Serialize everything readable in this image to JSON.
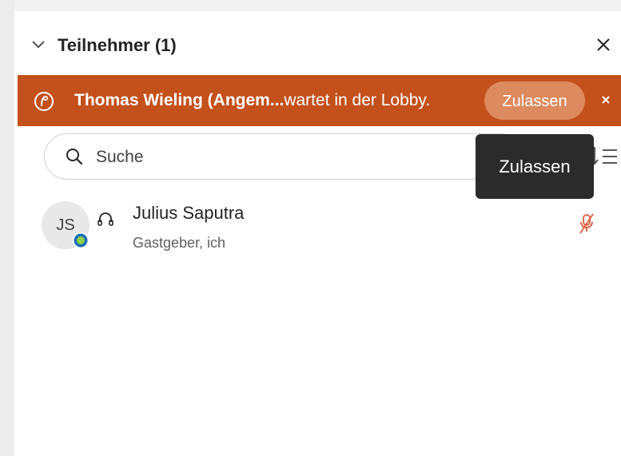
{
  "panel": {
    "title": "Teilnehmer (1)"
  },
  "lobby": {
    "name": "Thomas Wieling (Angem...",
    "message": "wartet in der Lobby.",
    "admit_label": "Zulassen",
    "dismiss_symbol": "×"
  },
  "search": {
    "placeholder": "Suche"
  },
  "tooltip": {
    "text": "Zulassen"
  },
  "participants": [
    {
      "initials": "JS",
      "name": "Julius Saputra",
      "role": "Gastgeber, ich",
      "muted": true
    }
  ],
  "colors": {
    "lobby_banner": "#c4501b",
    "admit_button": "#dc8a5e",
    "muted_mic": "#e05a3a",
    "tooltip": "#2b2b2b"
  },
  "icons": {
    "collapse": "chevron-down-icon",
    "close": "close-icon",
    "lobby": "lobby-clock-icon",
    "search": "search-icon",
    "sort": "sort-icon",
    "device": "headset-icon",
    "mic": "mic-off-icon"
  }
}
